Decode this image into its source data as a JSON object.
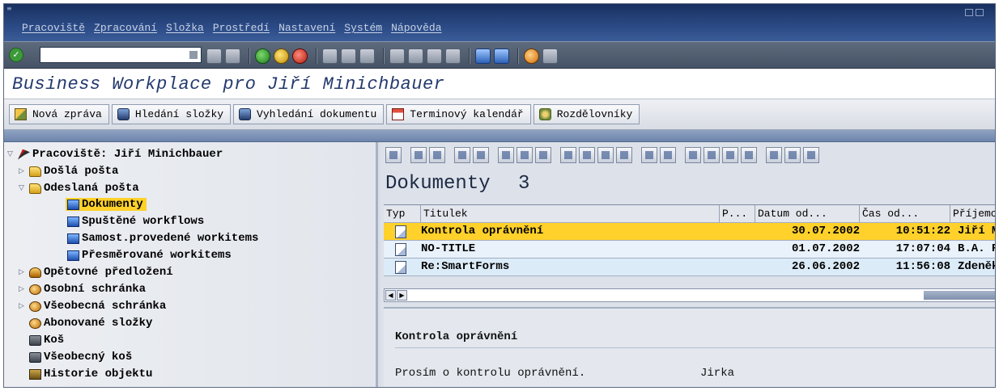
{
  "menu": [
    "Pracoviště",
    "Zpracování",
    "Složka",
    "Prostředí",
    "Nastavení",
    "Systém",
    "Nápověda"
  ],
  "title": "Business Workplace pro Jiří Minichbauer",
  "toolbar": {
    "buttons": [
      {
        "label": "Nová zpráva",
        "icon": "new-message-icon"
      },
      {
        "label": "Hledání složky",
        "icon": "binoculars-icon"
      },
      {
        "label": "Vyhledání dokumentu",
        "icon": "binoculars-icon"
      },
      {
        "label": "Terminový kalendář",
        "icon": "calendar-icon"
      },
      {
        "label": "Rozdělovníky",
        "icon": "distribution-list-icon"
      }
    ]
  },
  "tree": {
    "root": "Pracoviště: Jiří Minichbauer",
    "items": [
      {
        "label": "Došlá pošta"
      },
      {
        "label": "Odeslaná pošta"
      },
      {
        "label": "Dokumenty"
      },
      {
        "label": "Spuštěné workflows"
      },
      {
        "label": "Samost.provedené workitems"
      },
      {
        "label": "Přesměrované workitems"
      },
      {
        "label": "Opětovné předložení"
      },
      {
        "label": "Osobní schránka"
      },
      {
        "label": "Všeobecná schránka"
      },
      {
        "label": "Abonované složky"
      },
      {
        "label": "Koš"
      },
      {
        "label": "Všeobecný koš"
      },
      {
        "label": "Historie objektu"
      }
    ]
  },
  "documents": {
    "title": "Dokumenty",
    "count": "3",
    "columns": [
      "Typ",
      "Titulek",
      "P...",
      "Datum od...",
      "Čas od...",
      "Příjemce"
    ],
    "rows": [
      {
        "title": "Kontrola oprávnění",
        "date": "30.07.2002",
        "time": "10:51:22",
        "recipient": "Jiří Mini"
      },
      {
        "title": "NO-TITLE",
        "date": "01.07.2002",
        "time": "17:07:04",
        "recipient": "B.A. Pave"
      },
      {
        "title": "Re:SmartForms",
        "date": "26.06.2002",
        "time": "11:56:08",
        "recipient": "Zdeněk Ke"
      }
    ]
  },
  "preview": {
    "subject": "Kontrola oprávnění",
    "body": "Prosím o kontrolu oprávnění.",
    "signature": "Jirka"
  },
  "colors": {
    "selection": "#ffd12a",
    "menubar": "#2b4a85",
    "title_text": "#243a6e"
  }
}
